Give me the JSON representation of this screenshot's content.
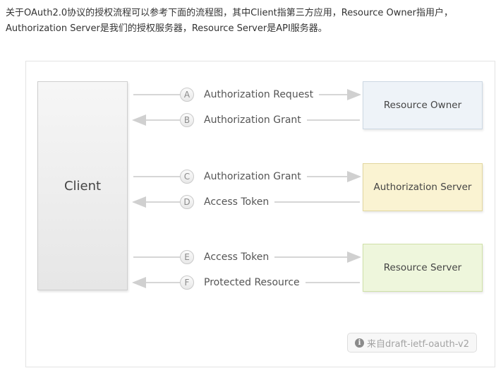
{
  "intro": {
    "line1": "关于OAuth2.0协议的授权流程可以参考下面的流程图，其中Client指第三方应用，Resource Owner指用户，",
    "line2": "Authorization Server是我们的授权服务器，Resource Server是API服务器。"
  },
  "diagram": {
    "client_label": "Client",
    "servers": [
      {
        "label": "Resource Owner",
        "color": "#eef3f8"
      },
      {
        "label": "Authorization Server",
        "color": "#faf3d2"
      },
      {
        "label": "Resource Server",
        "color": "#eef6dc"
      }
    ],
    "flows": [
      {
        "letter": "A",
        "label": "Authorization Request",
        "direction": "right"
      },
      {
        "letter": "B",
        "label": "Authorization Grant",
        "direction": "left"
      },
      {
        "letter": "C",
        "label": "Authorization Grant",
        "direction": "right"
      },
      {
        "letter": "D",
        "label": "Access Token",
        "direction": "left"
      },
      {
        "letter": "E",
        "label": "Access Token",
        "direction": "right"
      },
      {
        "letter": "F",
        "label": "Protected Resource",
        "direction": "left"
      }
    ],
    "source_label": "来自draft-ietf-oauth-v2",
    "source_icon": "info-icon"
  }
}
